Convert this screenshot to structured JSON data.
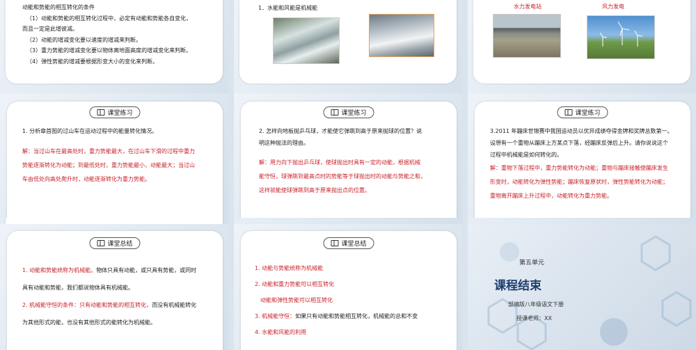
{
  "slide1": {
    "lines": [
      "动能和势能的相互转化的条件",
      "（1）动能和势能的相互转化过程中，必定有动能和势能各自变化，",
      "而且一定是此增彼减。",
      "（2）动能的增减变化要以速度的增减来判断。",
      "（3）重力势能的增减变化要以物体离地面高度的增减变化来判断。",
      "（4）弹性势能的增减要根据形变大小的变化来判断。"
    ]
  },
  "slide2": {
    "heading": "1．水能和风能是机械能"
  },
  "slide3": {
    "caption_left": "水力发电站",
    "caption_right": "风力发电"
  },
  "slide4": {
    "tag": "课堂练习",
    "question": "1. 分析章首图的过山车在运动过程中的能量转化情况。",
    "answer": [
      "解：当过山车在最高处时，重力势能最大，在过山车下滑的过程中重力",
      "势能逐渐转化为动能；到最低处时，重力势能最小，动能最大；当过山",
      "车由低处向高处爬升时，动能逐渐转化为重力势能。"
    ]
  },
  "slide5": {
    "tag": "课堂练习",
    "question": [
      "2. 怎样向地板抛乒乓球，才能使它弹跳到高于原来抛球的位置？说",
      "明这种抛法的理由。"
    ],
    "answer": [
      "解：用力向下抛出乒乓球，使球抛出时具有一定的动能，根据机械",
      "能守恒，球弹跳到最高点时的势能等于球抛出时的动能与势能之和，",
      "这样就能使球弹跳到高于原来抛出点的位置。"
    ]
  },
  "slide6": {
    "tag": "课堂练习",
    "question": [
      "3.2011 年蹦床世锦赛中我国运动员以优异成绩夺得金牌和奖牌总数第一。",
      "设想有一个重物从蹦床上方某点下落，经蹦床反弹后上升。请你说说这个",
      "过程中机械能是如何转化的。"
    ],
    "answer": [
      "解：重物下落过程中，重力势能转化为动能；重物与蹦床接触使蹦床发生",
      "形变时，动能转化为弹性势能；蹦床恢复原状时，弹性势能转化为动能；",
      "重物离开蹦床上升过程中，动能转化为重力势能。"
    ]
  },
  "slide7": {
    "tag": "课堂总结",
    "l1_red": "1. 动能和势能统称为机械能。",
    "l1_rest": "物体只具有动能，或只具有势能，或同时",
    "l2": "具有动能和势能，我们都说物体具有机械能。",
    "l3_red": "2. 机械能守恒的条件：只有动能和势能的相互转化，",
    "l3_rest": "而没有机械能转化",
    "l4": "为其他形式的能，也没有其他形式的能转化为机械能。"
  },
  "slide8": {
    "tag": "课堂总结",
    "items": [
      "1. 动能与势能统称为机械能",
      "2. 动能和重力势能可以相互转化",
      "动能和弹性势能可以相互转化",
      "3. 机械能守恒：",
      "如果只有动能和势能相互转化，机械能的总和不变",
      "4. 水能和风能的利用"
    ]
  },
  "slide9": {
    "unit": "第五单元",
    "title": "课程结束",
    "subtitle": "部编版八年级语文下册",
    "teacher": "授课老师：XX"
  }
}
